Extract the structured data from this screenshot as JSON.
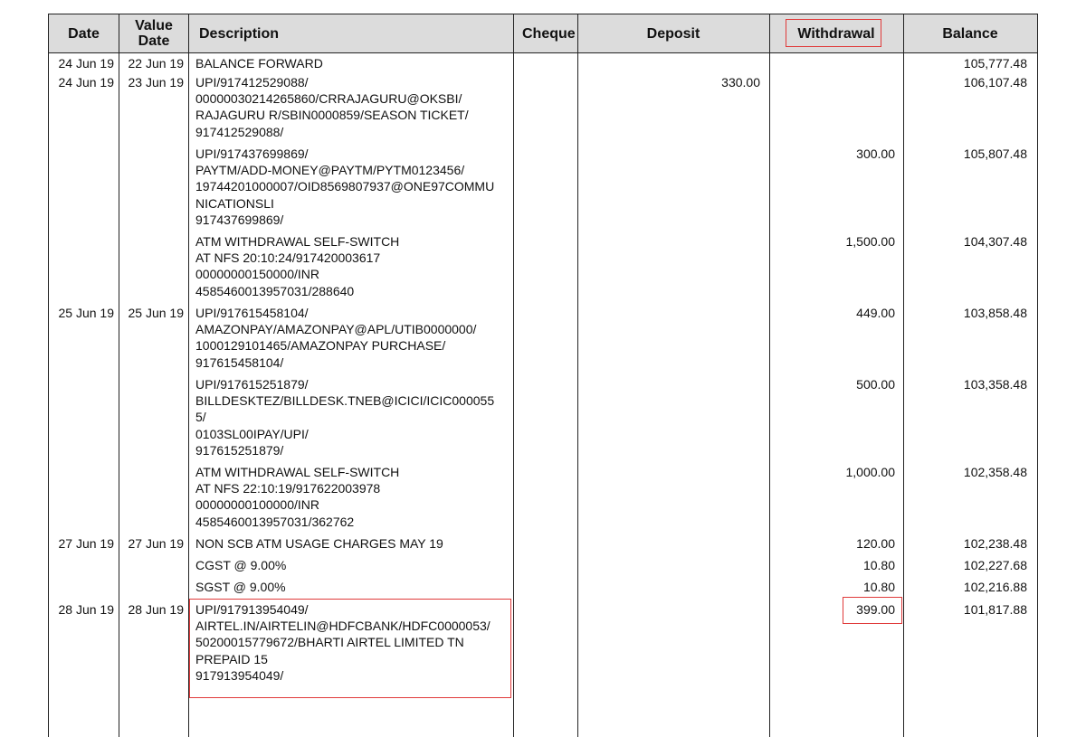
{
  "headers": {
    "date": "Date",
    "value_date": "Value\nDate",
    "description": "Description",
    "cheque": "Cheque",
    "deposit": "Deposit",
    "withdrawal": "Withdrawal",
    "balance": "Balance"
  },
  "rows": [
    {
      "date": "24 Jun 19",
      "value_date": "22 Jun 19",
      "description": [
        "BALANCE FORWARD"
      ],
      "cheque": "",
      "deposit": "",
      "withdrawal": "",
      "balance": "105,777.48"
    },
    {
      "date": "24 Jun 19",
      "value_date": "23 Jun 19",
      "description": [
        "UPI/917412529088/",
        "00000030214265860/CRRAJAGURU@OKSBI/",
        "RAJAGURU  R/SBIN0000859/SEASON TICKET/",
        "917412529088/"
      ],
      "cheque": "",
      "deposit": "330.00",
      "withdrawal": "",
      "balance": "106,107.48"
    },
    {
      "date": "",
      "value_date": "",
      "description": [
        "UPI/917437699869/",
        "PAYTM/ADD-MONEY@PAYTM/PYTM0123456/",
        "19744201000007/OID8569807937@ONE97COMMU",
        "NICATIONSLI",
        "917437699869/"
      ],
      "cheque": "",
      "deposit": "",
      "withdrawal": "300.00",
      "balance": "105,807.48"
    },
    {
      "date": "",
      "value_date": "",
      "description": [
        "ATM WITHDRAWAL SELF-SWITCH",
        "AT NFS 20:10:24/917420003617",
        "00000000150000/INR",
        "4585460013957031/288640"
      ],
      "cheque": "",
      "deposit": "",
      "withdrawal": "1,500.00",
      "balance": "104,307.48"
    },
    {
      "date": "25 Jun 19",
      "value_date": "25 Jun 19",
      "description": [
        "UPI/917615458104/",
        "AMAZONPAY/AMAZONPAY@APL/UTIB0000000/",
        "1000129101465/AMAZONPAY PURCHASE/",
        "917615458104/"
      ],
      "cheque": "",
      "deposit": "",
      "withdrawal": "449.00",
      "balance": "103,858.48"
    },
    {
      "date": "",
      "value_date": "",
      "description": [
        "UPI/917615251879/",
        "BILLDESKTEZ/BILLDESK.TNEB@ICICI/ICIC000055",
        "5/",
        "0103SL00IPAY/UPI/",
        "917615251879/"
      ],
      "cheque": "",
      "deposit": "",
      "withdrawal": "500.00",
      "balance": "103,358.48"
    },
    {
      "date": "",
      "value_date": "",
      "description": [
        "ATM WITHDRAWAL SELF-SWITCH",
        "AT NFS 22:10:19/917622003978",
        "00000000100000/INR",
        "4585460013957031/362762"
      ],
      "cheque": "",
      "deposit": "",
      "withdrawal": "1,000.00",
      "balance": "102,358.48"
    },
    {
      "date": "27 Jun 19",
      "value_date": "27 Jun 19",
      "description": [
        "NON SCB ATM USAGE CHARGES MAY 19"
      ],
      "cheque": "",
      "deposit": "",
      "withdrawal": "120.00",
      "balance": "102,238.48"
    },
    {
      "date": "",
      "value_date": "",
      "description": [
        "CGST @ 9.00%"
      ],
      "cheque": "",
      "deposit": "",
      "withdrawal": "10.80",
      "balance": "102,227.68"
    },
    {
      "date": "",
      "value_date": "",
      "description": [
        "SGST @ 9.00%"
      ],
      "cheque": "",
      "deposit": "",
      "withdrawal": "10.80",
      "balance": "102,216.88"
    },
    {
      "date": "28 Jun 19",
      "value_date": "28 Jun 19",
      "description": [
        "UPI/917913954049/",
        "AIRTEL.IN/AIRTELIN@HDFCBANK/HDFC0000053/",
        "50200015779672/BHARTI AIRTEL LIMITED TN",
        "PREPAID 15",
        "917913954049/"
      ],
      "cheque": "",
      "deposit": "",
      "withdrawal": "399.00",
      "balance": "101,817.88"
    }
  ],
  "highlight_color": "#e03a3a"
}
